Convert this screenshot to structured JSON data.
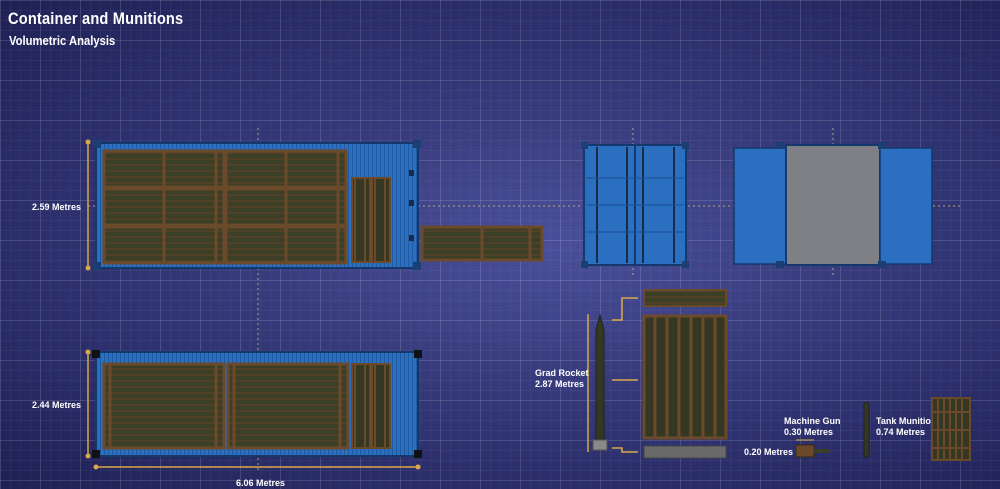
{
  "header": {
    "title": "Container and Munitions",
    "subtitle": "Volumetric Analysis"
  },
  "dimensions": {
    "height_side": "2.59 Metres",
    "height_top": "2.44 Metres",
    "length": "6.06 Metres"
  },
  "items": {
    "grad_rocket_name": "Grad Rocket",
    "grad_rocket_size": "2.87 Metres",
    "machine_gun_name": "Machine Gun",
    "machine_gun_size": "0.30 Metres",
    "machine_gun_width": "0.20 Metres",
    "tank_munition_name": "Tank Munition",
    "tank_munition_size": "0.74 Metres"
  },
  "colors": {
    "container_blue": "#2b6fc0",
    "container_dark": "#1d4e8f",
    "crate_brown": "#6b4a2b",
    "crate_green": "#3b3f26",
    "door_grey": "#7f7f86",
    "dimension_gold": "#d9a84a"
  }
}
